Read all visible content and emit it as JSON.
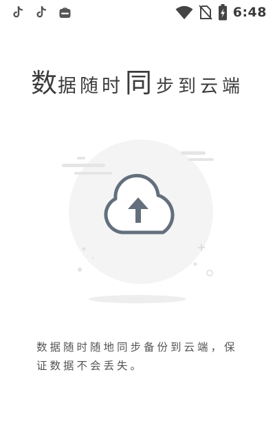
{
  "status_bar": {
    "time": "6:48",
    "notification_icons": [
      "tiktok-icon",
      "tiktok-icon",
      "app-store-icon"
    ],
    "system_icons": [
      "wifi-icon",
      "no-sim-icon",
      "battery-charging-icon"
    ]
  },
  "headline": {
    "part1": "数",
    "part2": "据随时",
    "part3": "同",
    "part4": "步到云端"
  },
  "illustration": {
    "icon": "cloud-upload-icon",
    "colors": {
      "circle": "#f4f4f4",
      "cloud_stroke": "#646f7d",
      "arrow": "#646f7d",
      "shadow": "#eeeeee",
      "decor": "#e4e4e4"
    }
  },
  "description": {
    "line1": "数据随时随地同步备份到云端，保",
    "line2": "证数据不会丢失。"
  }
}
